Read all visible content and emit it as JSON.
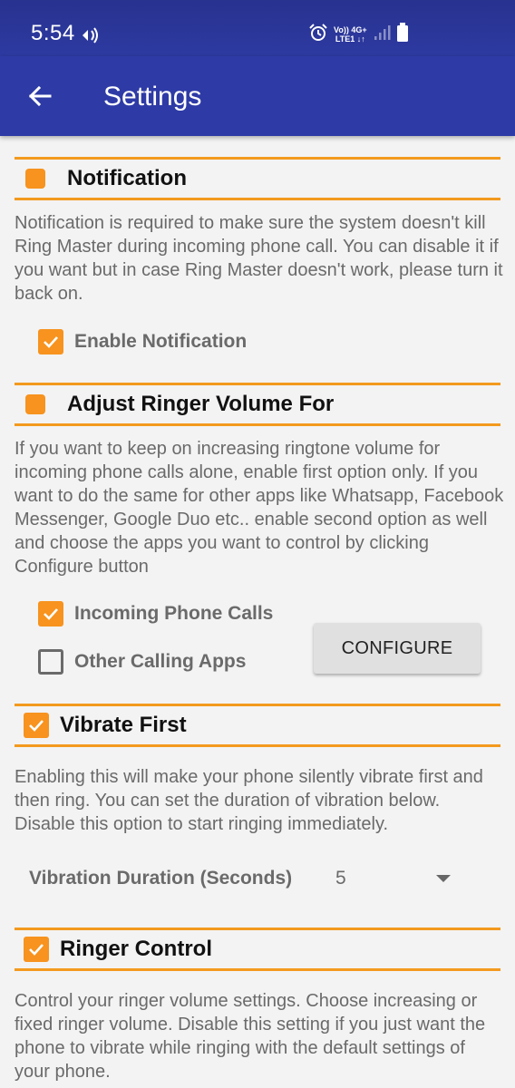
{
  "status_bar": {
    "time": "5:54",
    "net_line1": "Vo)) 4G+",
    "net_line2": "LTE1 ↓↑"
  },
  "app_bar": {
    "title": "Settings"
  },
  "notification": {
    "title": "Notification",
    "description": "Notification is required to make sure the system doesn't kill Ring Master during incoming phone call. You can disable it if you want but in case Ring Master doesn't work, please turn it back on.",
    "enable_label": "Enable Notification",
    "enable_checked": true
  },
  "ringer_volume": {
    "title": "Adjust Ringer Volume For",
    "description": "If you want to keep on increasing ringtone volume for incoming phone calls alone, enable first option only. If you want to do the same for other apps like Whatsapp, Facebook Messenger, Google Duo etc.. enable second option as well and choose the apps you want to control by clicking Configure button",
    "option_calls_label": "Incoming Phone Calls",
    "option_calls_checked": true,
    "option_apps_label": "Other Calling Apps",
    "option_apps_checked": false,
    "configure_label": "CONFIGURE"
  },
  "vibrate_first": {
    "title": "Vibrate First",
    "checked": true,
    "description": "Enabling this will make your phone silently vibrate first and then ring. You can set the duration of vibration below. Disable this option to start ringing immediately.",
    "duration_label": "Vibration Duration (Seconds)",
    "duration_value": "5"
  },
  "ringer_control": {
    "title": "Ringer Control",
    "checked": true,
    "description": "Control your ringer volume settings. Choose increasing or fixed ringer volume. Disable this setting if you just want the phone to vibrate while ringing with the default settings of your phone."
  },
  "colors": {
    "app_bar": "#2e3ba6",
    "accent": "#f7931e",
    "background": "#f3f3f3"
  }
}
